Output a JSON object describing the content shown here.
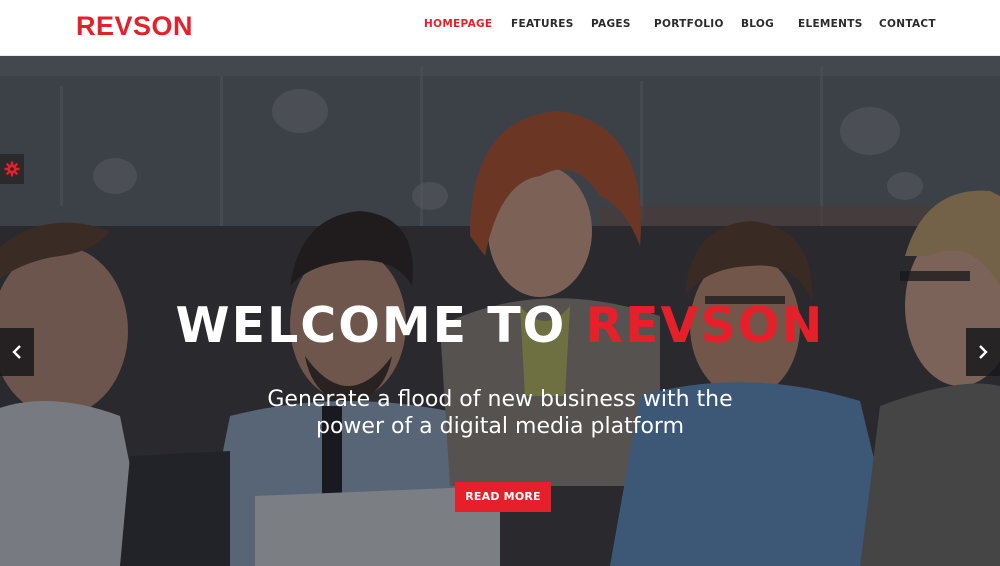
{
  "brand": {
    "logo_text": "REVSON",
    "accent_color": "#e6202b"
  },
  "nav": {
    "items": [
      {
        "label": "HOMEPAGE",
        "active": true
      },
      {
        "label": "FEATURES",
        "active": false
      },
      {
        "label": "PAGES",
        "active": false
      },
      {
        "label": "PORTFOLIO",
        "active": false
      },
      {
        "label": "BLOG",
        "active": false
      },
      {
        "label": "ELEMENTS",
        "active": false
      },
      {
        "label": "CONTACT",
        "active": false
      }
    ]
  },
  "hero": {
    "title_prefix": "WELCOME TO",
    "title_highlight": "REVSON",
    "subtitle_line1": "Generate a flood of new business with the",
    "subtitle_line2": "power of a digital media platform",
    "cta_label": "READ MORE",
    "prev_icon": "chevron-left-icon",
    "next_icon": "chevron-right-icon",
    "settings_icon": "gear-icon"
  }
}
